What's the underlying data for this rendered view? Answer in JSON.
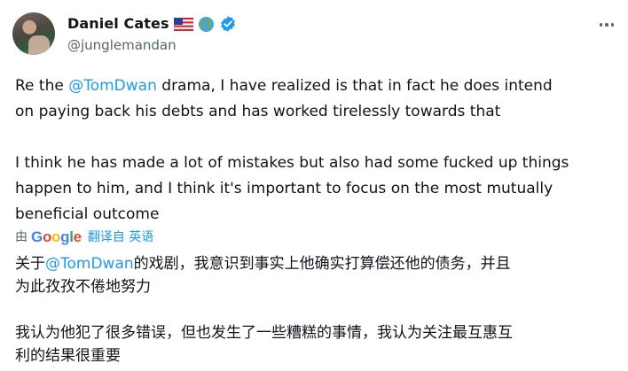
{
  "user": {
    "display_name": "Daniel Cates",
    "handle": "@junglemandan",
    "badges": [
      "flag-us-icon",
      "globe-icon",
      "verified-badge-icon"
    ],
    "verified_color": "#1d9bf0"
  },
  "tweet": {
    "p1_prefix": "Re the ",
    "p1_mention": "@TomDwan",
    "p1_line1_rest": " drama, I have realized is that in fact he does intend",
    "p1_line2": "on paying back his debts and has worked tirelessly towards that",
    "p2_line1": "I think he has made a lot of mistakes but also had some fucked up things",
    "p2_line2": "happen to him, and I think it's important to focus on the most mutually",
    "p2_line3": "beneficial outcome"
  },
  "translation_bar": {
    "by_label": "由",
    "logo_letters": [
      "G",
      "o",
      "o",
      "g",
      "l",
      "e"
    ],
    "link_label": "翻译自 英语"
  },
  "translated": {
    "p1_prefix": "关于",
    "p1_mention": "@TomDwan",
    "p1_line1_rest": "的戏剧，我意识到事实上他确实打算偿还他的债务，并且",
    "p1_line2": "为此孜孜不倦地努力",
    "p2_line1": "我认为他犯了很多错误，但也发生了一些糟糕的事情，我认为关注最互惠互",
    "p2_line2": "利的结果很重要"
  },
  "colors": {
    "text": "#0f1419",
    "secondary": "#536471",
    "accent": "#1d9bf0"
  }
}
